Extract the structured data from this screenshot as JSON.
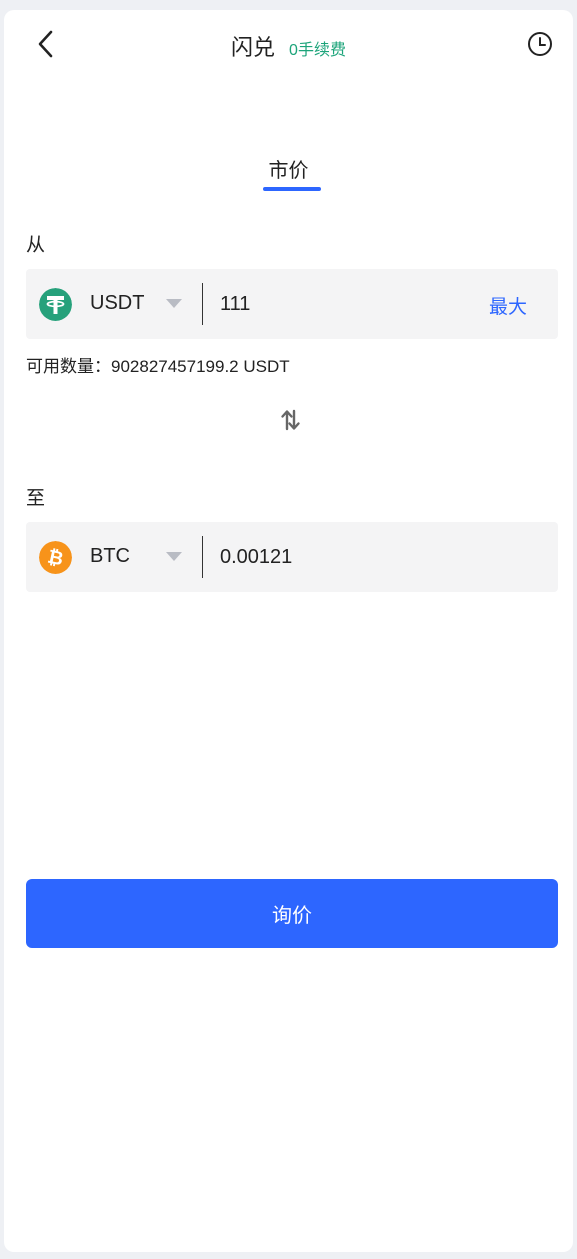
{
  "header": {
    "title": "闪兑",
    "fee_badge": "0手续费"
  },
  "tabs": [
    {
      "label": "市价",
      "active": true
    }
  ],
  "from": {
    "label": "从",
    "coin": "USDT",
    "coin_icon": "tether-icon",
    "coin_color": "#26a17b",
    "amount": "111",
    "max_label": "最大",
    "available_text": "可用数量：902827457199.2 USDT"
  },
  "to": {
    "label": "至",
    "coin": "BTC",
    "coin_icon": "bitcoin-icon",
    "coin_color": "#f7931a",
    "amount": "0.00121"
  },
  "action": {
    "quote_label": "询价"
  },
  "colors": {
    "accent": "#2d66ff",
    "fee_green": "#1ca47a",
    "field_bg": "#f4f4f5"
  }
}
